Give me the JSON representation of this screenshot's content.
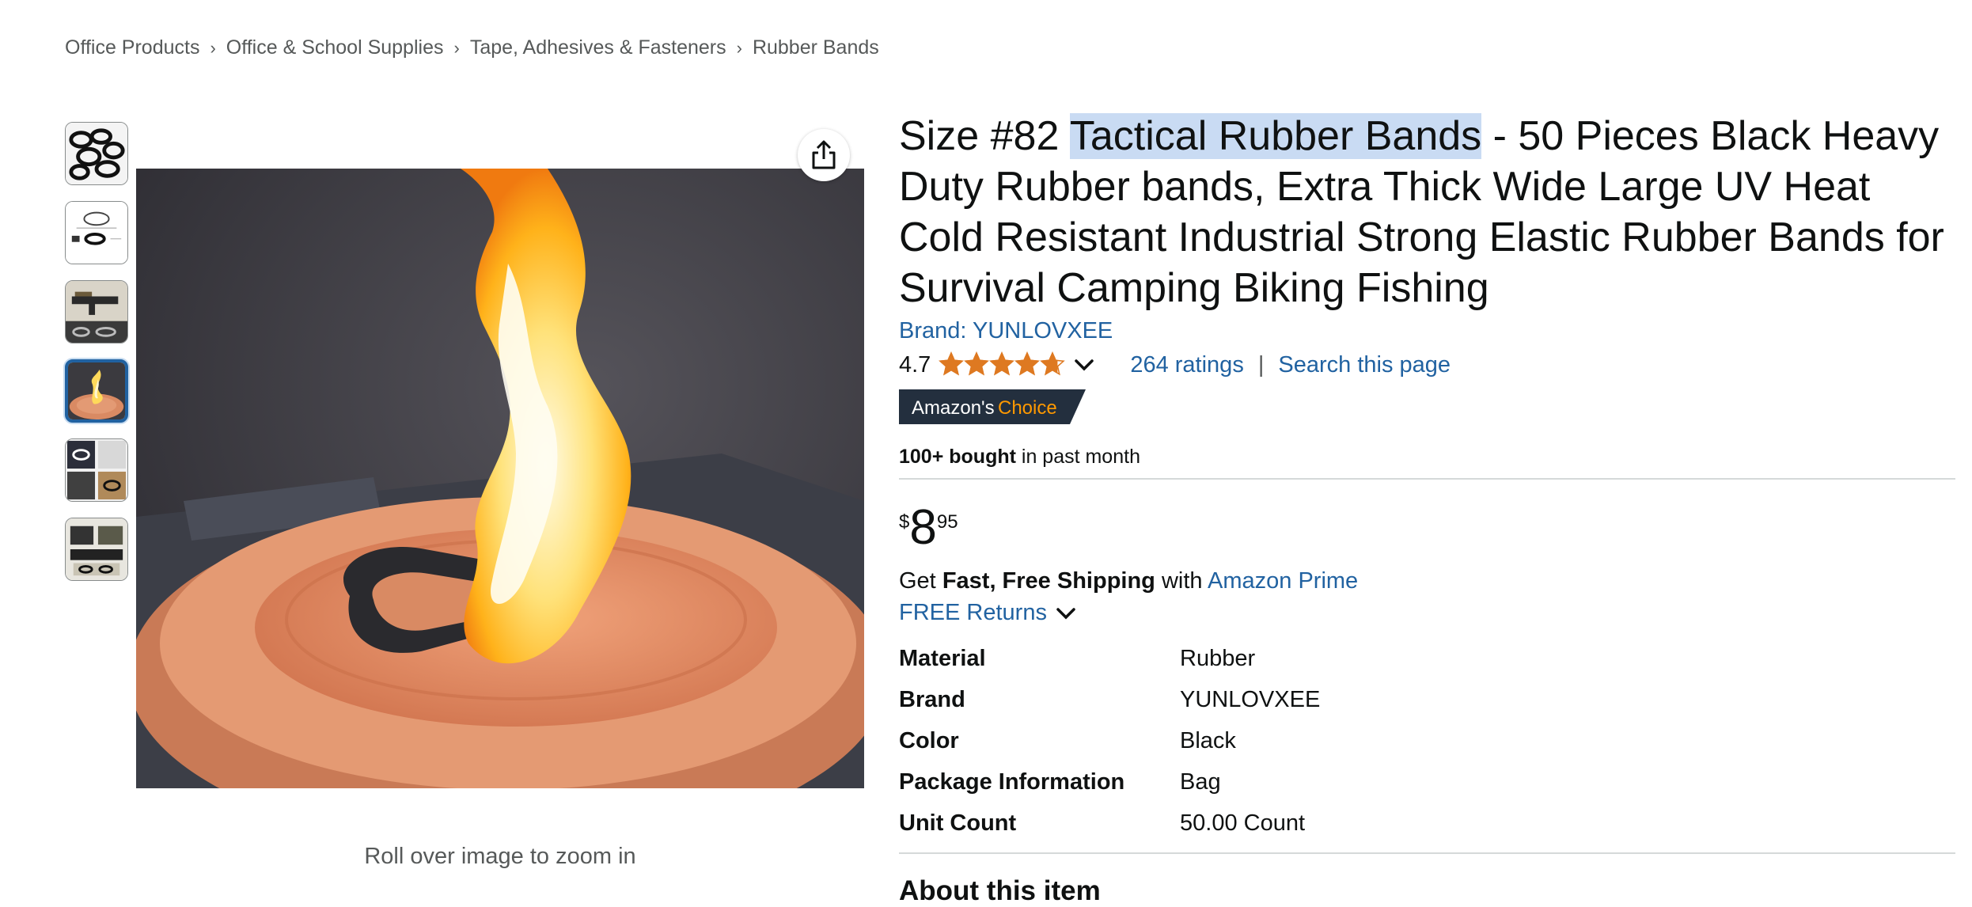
{
  "breadcrumb": [
    "Office Products",
    "Office & School Supplies",
    "Tape, Adhesives & Fasteners",
    "Rubber Bands"
  ],
  "thumbnails": [
    {
      "icon": "rubber-bands-thumbnail"
    },
    {
      "icon": "dimension-diagram-thumbnail"
    },
    {
      "icon": "rifle-thumbnail"
    },
    {
      "icon": "flame-thumbnail",
      "selected": true
    },
    {
      "icon": "uses-collage-thumbnail"
    },
    {
      "icon": "gear-collage-thumbnail"
    }
  ],
  "main_image": {
    "icon": "burning-rubber-band-image"
  },
  "zoom_hint": "Roll over image to zoom in",
  "product": {
    "title_before": "Size #82 ",
    "title_highlight": "Tactical Rubber Bands",
    "title_after": " - 50 Pieces Black Heavy Duty Rubber bands, Extra Thick Wide Large UV Heat Cold Resistant Industrial Strong Elastic Rubber Bands for Survival Camping Biking Fishing",
    "brand": "Brand: YUNLOVXEE",
    "rating": "4.7",
    "rating_fraction": 0.94,
    "ratings_count": "264 ratings",
    "search_link": "Search this page",
    "badge": {
      "prefix": "Amazon's",
      "suffix": "Choice"
    },
    "bought": {
      "bold": "100+ bought",
      "rest": " in past month"
    },
    "price": {
      "symbol": "$",
      "whole": "8",
      "fraction": "95"
    },
    "shipping": {
      "get": "Get ",
      "bold": "Fast, Free Shipping",
      "with": " with ",
      "prime": "Amazon Prime"
    },
    "returns": "FREE Returns",
    "specs": [
      {
        "label": "Material",
        "value": "Rubber"
      },
      {
        "label": "Brand",
        "value": "YUNLOVXEE"
      },
      {
        "label": "Color",
        "value": "Black"
      },
      {
        "label": "Package Information",
        "value": "Bag"
      },
      {
        "label": "Unit Count",
        "value": "50.00 Count"
      }
    ],
    "about_heading": "About this item"
  },
  "colors": {
    "link": "#2162a1",
    "star": "#de7921",
    "badge_bg": "#232f3e",
    "badge_accent": "#ff9900",
    "highlight": "#c9dbf3"
  }
}
